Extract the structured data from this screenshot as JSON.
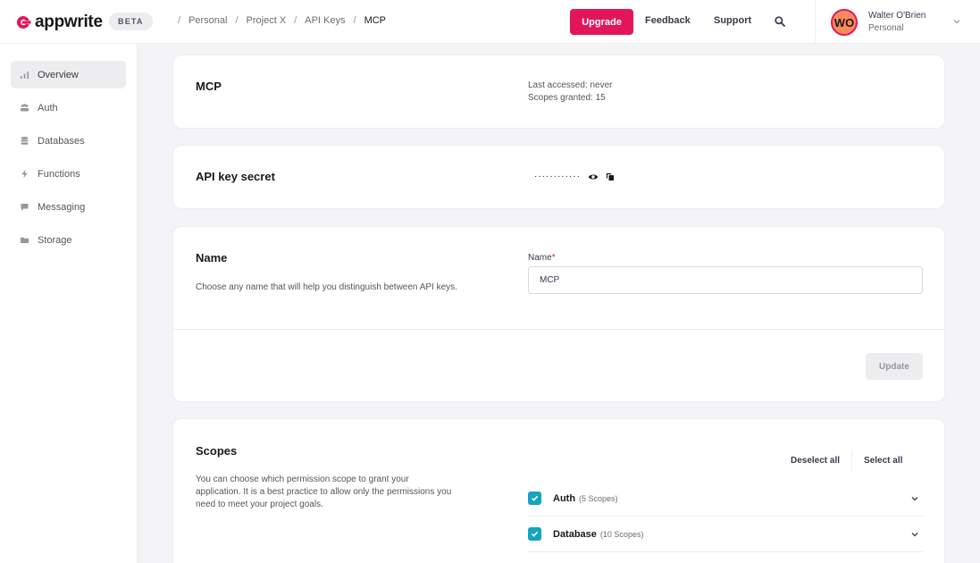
{
  "header": {
    "logo_text": "appwrite",
    "beta_badge": "BETA",
    "breadcrumbs": [
      "Personal",
      "Project X",
      "API Keys",
      "MCP"
    ],
    "upgrade_label": "Upgrade",
    "feedback_label": "Feedback",
    "support_label": "Support",
    "user": {
      "initials": "WO",
      "name": "Walter O'Brien",
      "org": "Personal"
    }
  },
  "sidebar": {
    "items": [
      {
        "label": "Overview",
        "icon": "chart-bars-icon",
        "active": true
      },
      {
        "label": "Auth",
        "icon": "users-icon",
        "active": false
      },
      {
        "label": "Databases",
        "icon": "database-icon",
        "active": false
      },
      {
        "label": "Functions",
        "icon": "lightning-icon",
        "active": false
      },
      {
        "label": "Messaging",
        "icon": "chat-icon",
        "active": false
      },
      {
        "label": "Storage",
        "icon": "folder-icon",
        "active": false
      }
    ]
  },
  "key_info": {
    "title": "MCP",
    "last_accessed": "Last accessed: never",
    "scopes_granted": "Scopes granted: 15"
  },
  "secret": {
    "title": "API key secret",
    "masked": "············"
  },
  "name_card": {
    "title": "Name",
    "description": "Choose any name that will help you distinguish between API keys.",
    "field_label": "Name",
    "required_mark": "*",
    "value": "MCP",
    "update_label": "Update"
  },
  "scopes": {
    "title": "Scopes",
    "description": "You can choose which permission scope to grant your application. It is a best practice to allow only the permissions you need to meet your project goals.",
    "deselect_label": "Deselect all",
    "select_label": "Select all",
    "groups": [
      {
        "name": "Auth",
        "count": "(5 Scopes)",
        "checked": true
      },
      {
        "name": "Database",
        "count": "(10 Scopes)",
        "checked": true
      }
    ]
  },
  "colors": {
    "brand_pink": "#e3165b",
    "checkbox_teal": "#14a4bd",
    "avatar_orange": "#fd8a5c"
  }
}
